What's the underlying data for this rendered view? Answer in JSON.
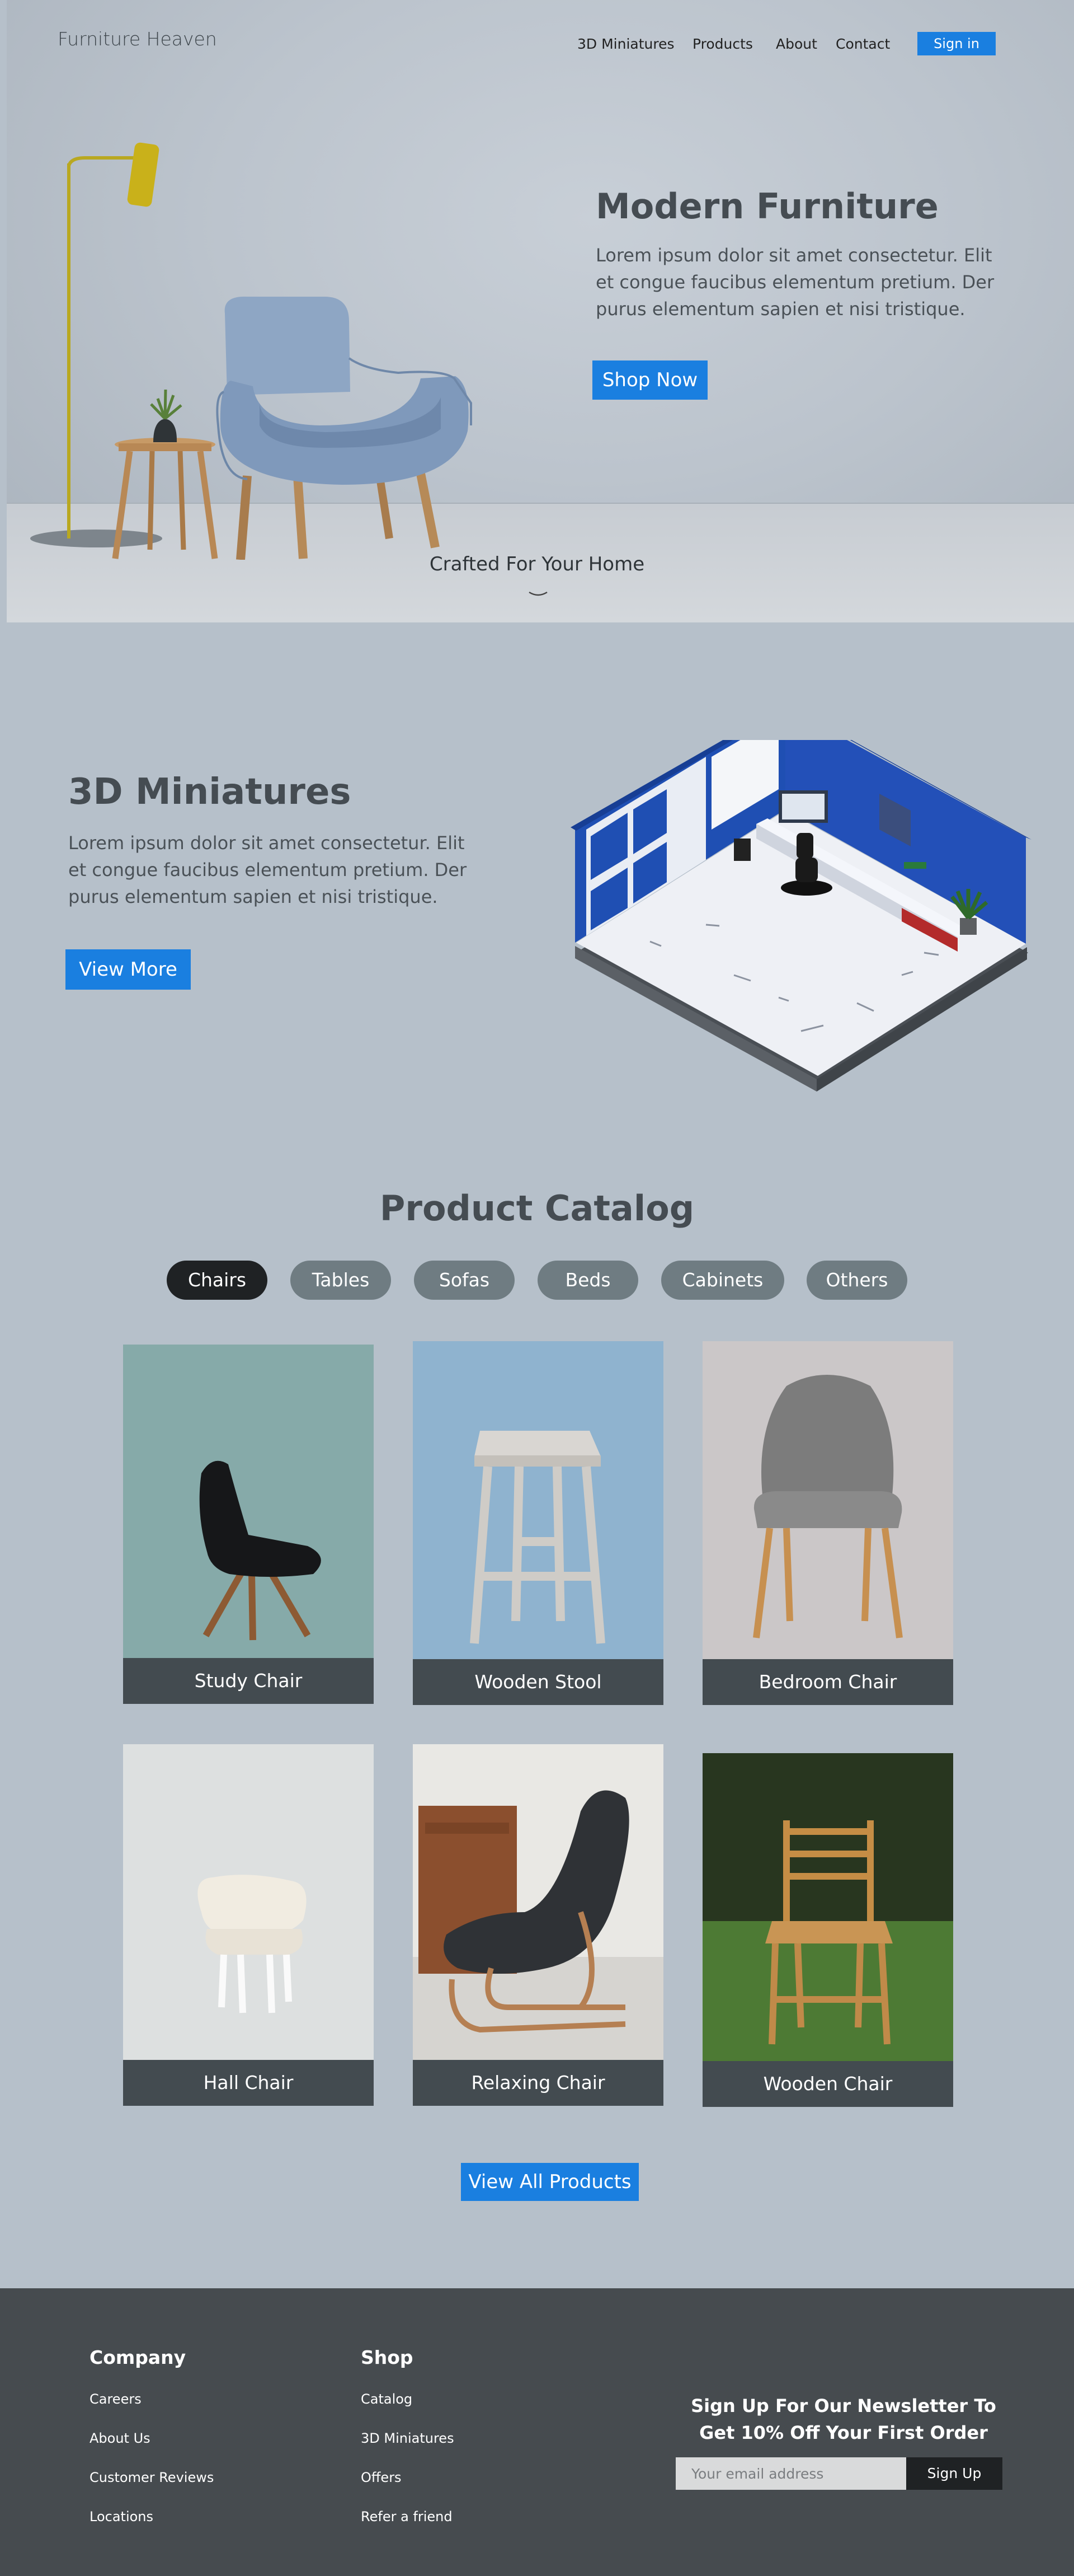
{
  "header": {
    "brand": "Furniture Heaven",
    "nav": [
      "3D Miniatures",
      "Products",
      "About",
      "Contact"
    ],
    "signin": "Sign in"
  },
  "hero": {
    "title": "Modern Furniture",
    "text": "Lorem ipsum dolor sit amet consectetur. Elit et congue faucibus elementum pretium. Der purus elementum sapien et nisi tristique.",
    "button": "Shop Now",
    "tagline": "Crafted For Your Home",
    "scroll_icon": "chevron-down-icon"
  },
  "miniatures": {
    "title": "3D Miniatures",
    "text": "Lorem ipsum dolor sit amet consectetur. Elit et congue faucibus elementum pretium. Der purus elementum sapien et nisi tristique.",
    "button": "View More"
  },
  "catalog": {
    "title": "Product Catalog",
    "filters": [
      "Chairs",
      "Tables",
      "Sofas",
      "Beds",
      "Cabinets",
      "Others"
    ],
    "active_filter": "Chairs",
    "products": [
      {
        "name": "Study Chair"
      },
      {
        "name": "Wooden Stool"
      },
      {
        "name": "Bedroom Chair"
      },
      {
        "name": "Hall Chair"
      },
      {
        "name": "Relaxing Chair"
      },
      {
        "name": "Wooden Chair"
      }
    ],
    "view_all": "View All Products"
  },
  "footer": {
    "company": {
      "title": "Company",
      "links": [
        "Careers",
        "About Us",
        "Customer Reviews",
        "Locations"
      ]
    },
    "shop": {
      "title": "Shop",
      "links": [
        "Catalog",
        "3D Miniatures",
        "Offers",
        "Refer a friend"
      ]
    },
    "newsletter": {
      "line1": "Sign Up For Our Newsletter To",
      "line2": "Get 10% Off Your First Order",
      "placeholder": "Your email address",
      "button": "Sign Up"
    }
  },
  "colors": {
    "accent": "#1a7fe0",
    "page_bg": "#b6c0ca",
    "footer_bg": "#464b4f",
    "caption_bg": "#434b50"
  }
}
